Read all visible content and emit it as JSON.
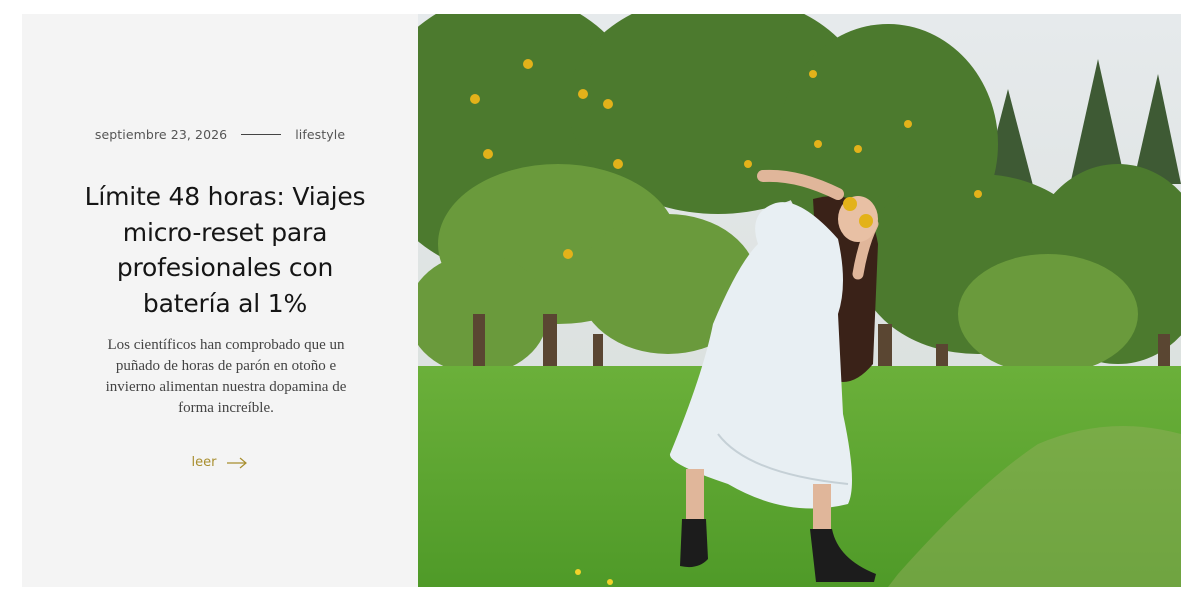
{
  "post": {
    "date": "septiembre 23, 2026",
    "category": "lifestyle",
    "title": "Límite 48 horas: Viajes micro-reset para profesionales con batería al 1%",
    "excerpt": "Los científicos han comprobado que un puñado de horas de parón en otoño e invierno alimentan nuestra dopamina de forma increíble.",
    "read_more": "leer"
  },
  "colors": {
    "panel_bg": "#f4f4f4",
    "accent": "#a88e2e",
    "title": "#151515"
  },
  "icons": {
    "read_more": "arrow-right-icon"
  }
}
